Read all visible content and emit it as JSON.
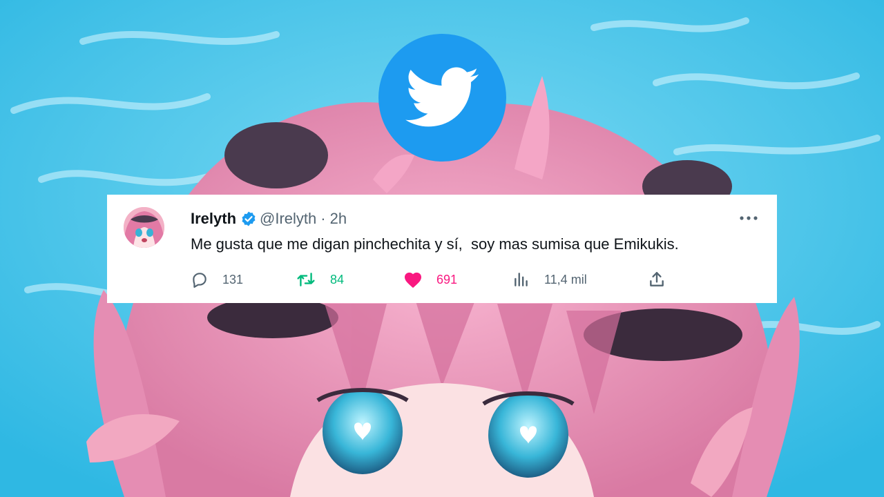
{
  "colors": {
    "twitter_blue": "#1d9bf0",
    "retweet_green": "#00ba7c",
    "like_pink": "#f91880",
    "muted_text": "#536471",
    "text": "#0f1419",
    "background_sky": "#44c6ea",
    "background_hair": "#e98fb4"
  },
  "logo": {
    "icon": "twitter-bird-icon"
  },
  "tweet": {
    "display_name": "Irelyth",
    "verified": true,
    "handle": "@Irelyth",
    "separator": "·",
    "timestamp": "2h",
    "text": "Me gusta que me digan pinchechita y sí,  soy mas sumisa que Emikukis.",
    "actions": {
      "replies": "131",
      "retweets": "84",
      "likes": "691",
      "views": "11,4 mil"
    },
    "icons": [
      "more-icon",
      "reply-icon",
      "retweet-icon",
      "like-icon",
      "views-icon",
      "share-icon"
    ]
  }
}
